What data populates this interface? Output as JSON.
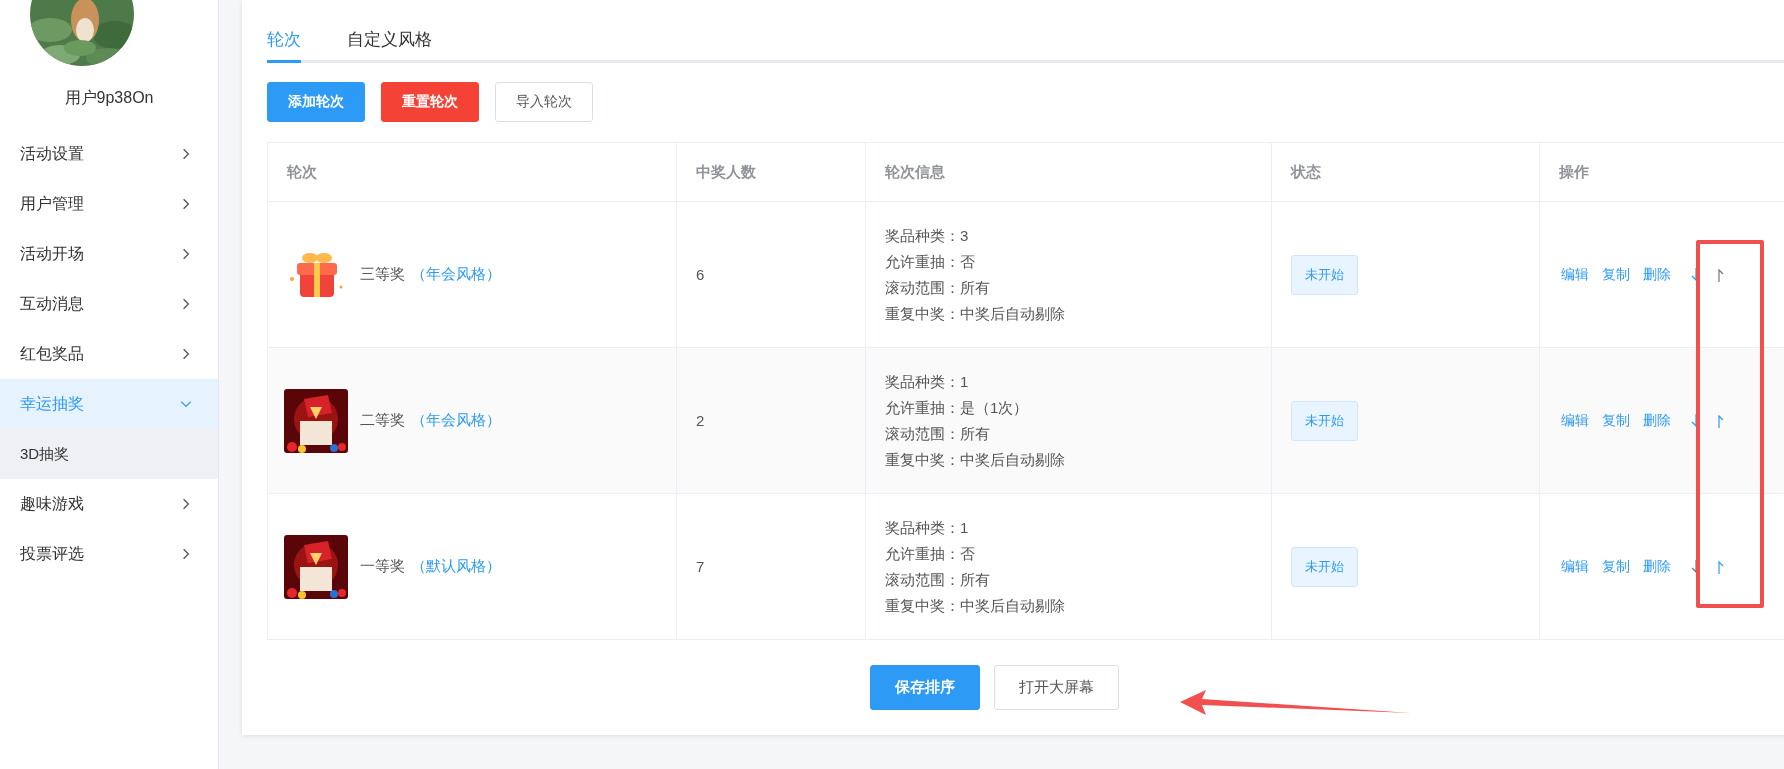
{
  "sidebar": {
    "avatar": {
      "kind": "picture"
    },
    "username": "用户9p38On",
    "menu": [
      {
        "label": "活动设置",
        "expanded": false,
        "selected": false
      },
      {
        "label": "用户管理",
        "expanded": false,
        "selected": false
      },
      {
        "label": "活动开场",
        "expanded": false,
        "selected": false
      },
      {
        "label": "互动消息",
        "expanded": false,
        "selected": false
      },
      {
        "label": "红包奖品",
        "expanded": false,
        "selected": false
      },
      {
        "label": "幸运抽奖",
        "expanded": true,
        "selected": true,
        "children": [
          {
            "label": "3D抽奖",
            "selected": true
          }
        ]
      },
      {
        "label": "趣味游戏",
        "expanded": false,
        "selected": false
      },
      {
        "label": "投票评选",
        "expanded": false,
        "selected": false
      }
    ]
  },
  "tabs": [
    {
      "label": "轮次",
      "selected": true
    },
    {
      "label": "自定义风格",
      "selected": false
    }
  ],
  "toolbar": [
    {
      "label": "添加轮次",
      "kind": "primary"
    },
    {
      "label": "重置轮次",
      "kind": "danger"
    },
    {
      "label": "导入轮次",
      "kind": "default"
    }
  ],
  "table": {
    "columns": [
      "轮次",
      "中奖人数",
      "轮次信息",
      "状态",
      "操作"
    ],
    "rows": [
      {
        "image": {
          "kind": "picture"
        },
        "name": "三等奖",
        "style": "（年会风格）",
        "winners": "6",
        "info": [
          "奖品种类：3",
          "允许重抽：否",
          "滚动范围：所有",
          "重复中奖：中奖后自动剔除"
        ],
        "status": "未开始",
        "actions": [
          "编辑",
          "复制",
          "删除"
        ],
        "move_down_disabled": false,
        "move_up_disabled": true
      },
      {
        "image": {
          "kind": "picture"
        },
        "name": "二等奖",
        "style": "（年会风格）",
        "winners": "2",
        "info": [
          "奖品种类：1",
          "允许重抽：是（1次）",
          "滚动范围：所有",
          "重复中奖：中奖后自动剔除"
        ],
        "status": "未开始",
        "actions": [
          "编辑",
          "复制",
          "删除"
        ],
        "move_down_disabled": false,
        "move_up_disabled": false
      },
      {
        "image": {
          "kind": "picture"
        },
        "name": "一等奖",
        "style": "（默认风格）",
        "winners": "7",
        "info": [
          "奖品种类：1",
          "允许重抽：否",
          "滚动范围：所有",
          "重复中奖：中奖后自动剔除"
        ],
        "status": "未开始",
        "actions": [
          "编辑",
          "复制",
          "删除"
        ],
        "move_down_disabled": true,
        "move_up_disabled": false
      }
    ]
  },
  "footer": [
    {
      "label": "保存排序",
      "kind": "primary"
    },
    {
      "label": "打开大屏幕",
      "kind": "default"
    }
  ]
}
